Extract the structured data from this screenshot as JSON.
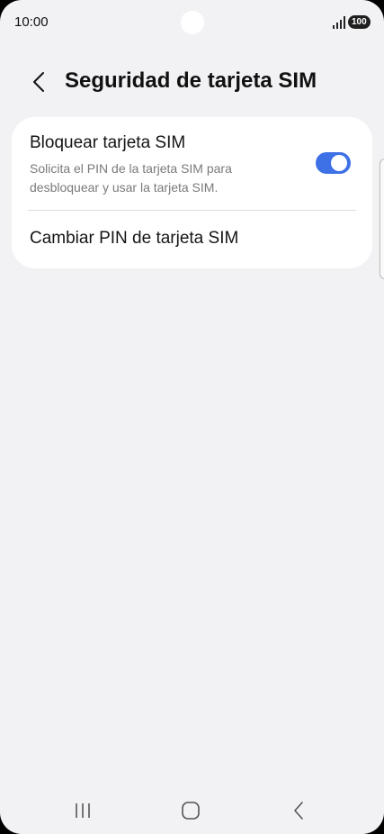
{
  "status_bar": {
    "time": "10:00",
    "signal_icon": "signal-bars-icon",
    "battery_level": "100"
  },
  "header": {
    "back_icon": "chevron-left-icon",
    "title": "Seguridad de tarjeta SIM"
  },
  "settings": {
    "lock_sim": {
      "title": "Bloquear tarjeta SIM",
      "subtitle": "Solicita el PIN de la tarjeta SIM para desbloquear y usar la tarjeta SIM.",
      "enabled": true
    },
    "change_pin": {
      "title": "Cambiar PIN de tarjeta SIM"
    }
  },
  "nav_bar": {
    "recents_icon": "recents-icon",
    "home_icon": "home-icon",
    "back_icon": "back-icon"
  },
  "colors": {
    "background": "#f2f2f4",
    "card": "#ffffff",
    "toggle_on": "#3e70e6",
    "subtitle": "#7a7a7a"
  }
}
